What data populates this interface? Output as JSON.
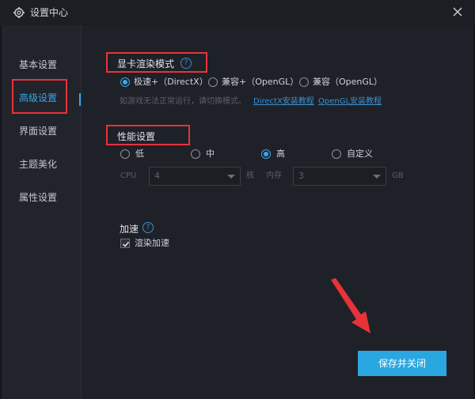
{
  "window": {
    "title": "设置中心"
  },
  "sidebar": {
    "items": [
      {
        "label": "基本设置"
      },
      {
        "label": "高级设置"
      },
      {
        "label": "界面设置"
      },
      {
        "label": "主题美化"
      },
      {
        "label": "属性设置"
      }
    ],
    "active_index": 1
  },
  "render_mode": {
    "title": "显卡渲染模式",
    "options": [
      {
        "label": "极速+（DirectX）",
        "checked": true
      },
      {
        "label": "兼容+（OpenGL）",
        "checked": false
      },
      {
        "label": "兼容（OpenGL）",
        "checked": false
      }
    ],
    "hint": "如游戏无法正常运行，请切换模式。",
    "links": [
      "DirectX安装教程",
      "OpenGL安装教程"
    ]
  },
  "performance": {
    "title": "性能设置",
    "options": [
      {
        "label": "低",
        "checked": false
      },
      {
        "label": "中",
        "checked": false
      },
      {
        "label": "高",
        "checked": true
      },
      {
        "label": "自定义",
        "checked": false
      }
    ],
    "cpu_label": "CPU",
    "cpu_value": "4",
    "cpu_unit": "核",
    "mem_label": "内存",
    "mem_value": "3",
    "mem_unit": "GB"
  },
  "acceleration": {
    "title": "加速",
    "checkbox_label": "渲染加速",
    "checked": true
  },
  "footer": {
    "save_label": "保存并关闭"
  },
  "colors": {
    "accent": "#2aa7e0",
    "highlight": "#e8323a",
    "background": "#1f2128"
  }
}
